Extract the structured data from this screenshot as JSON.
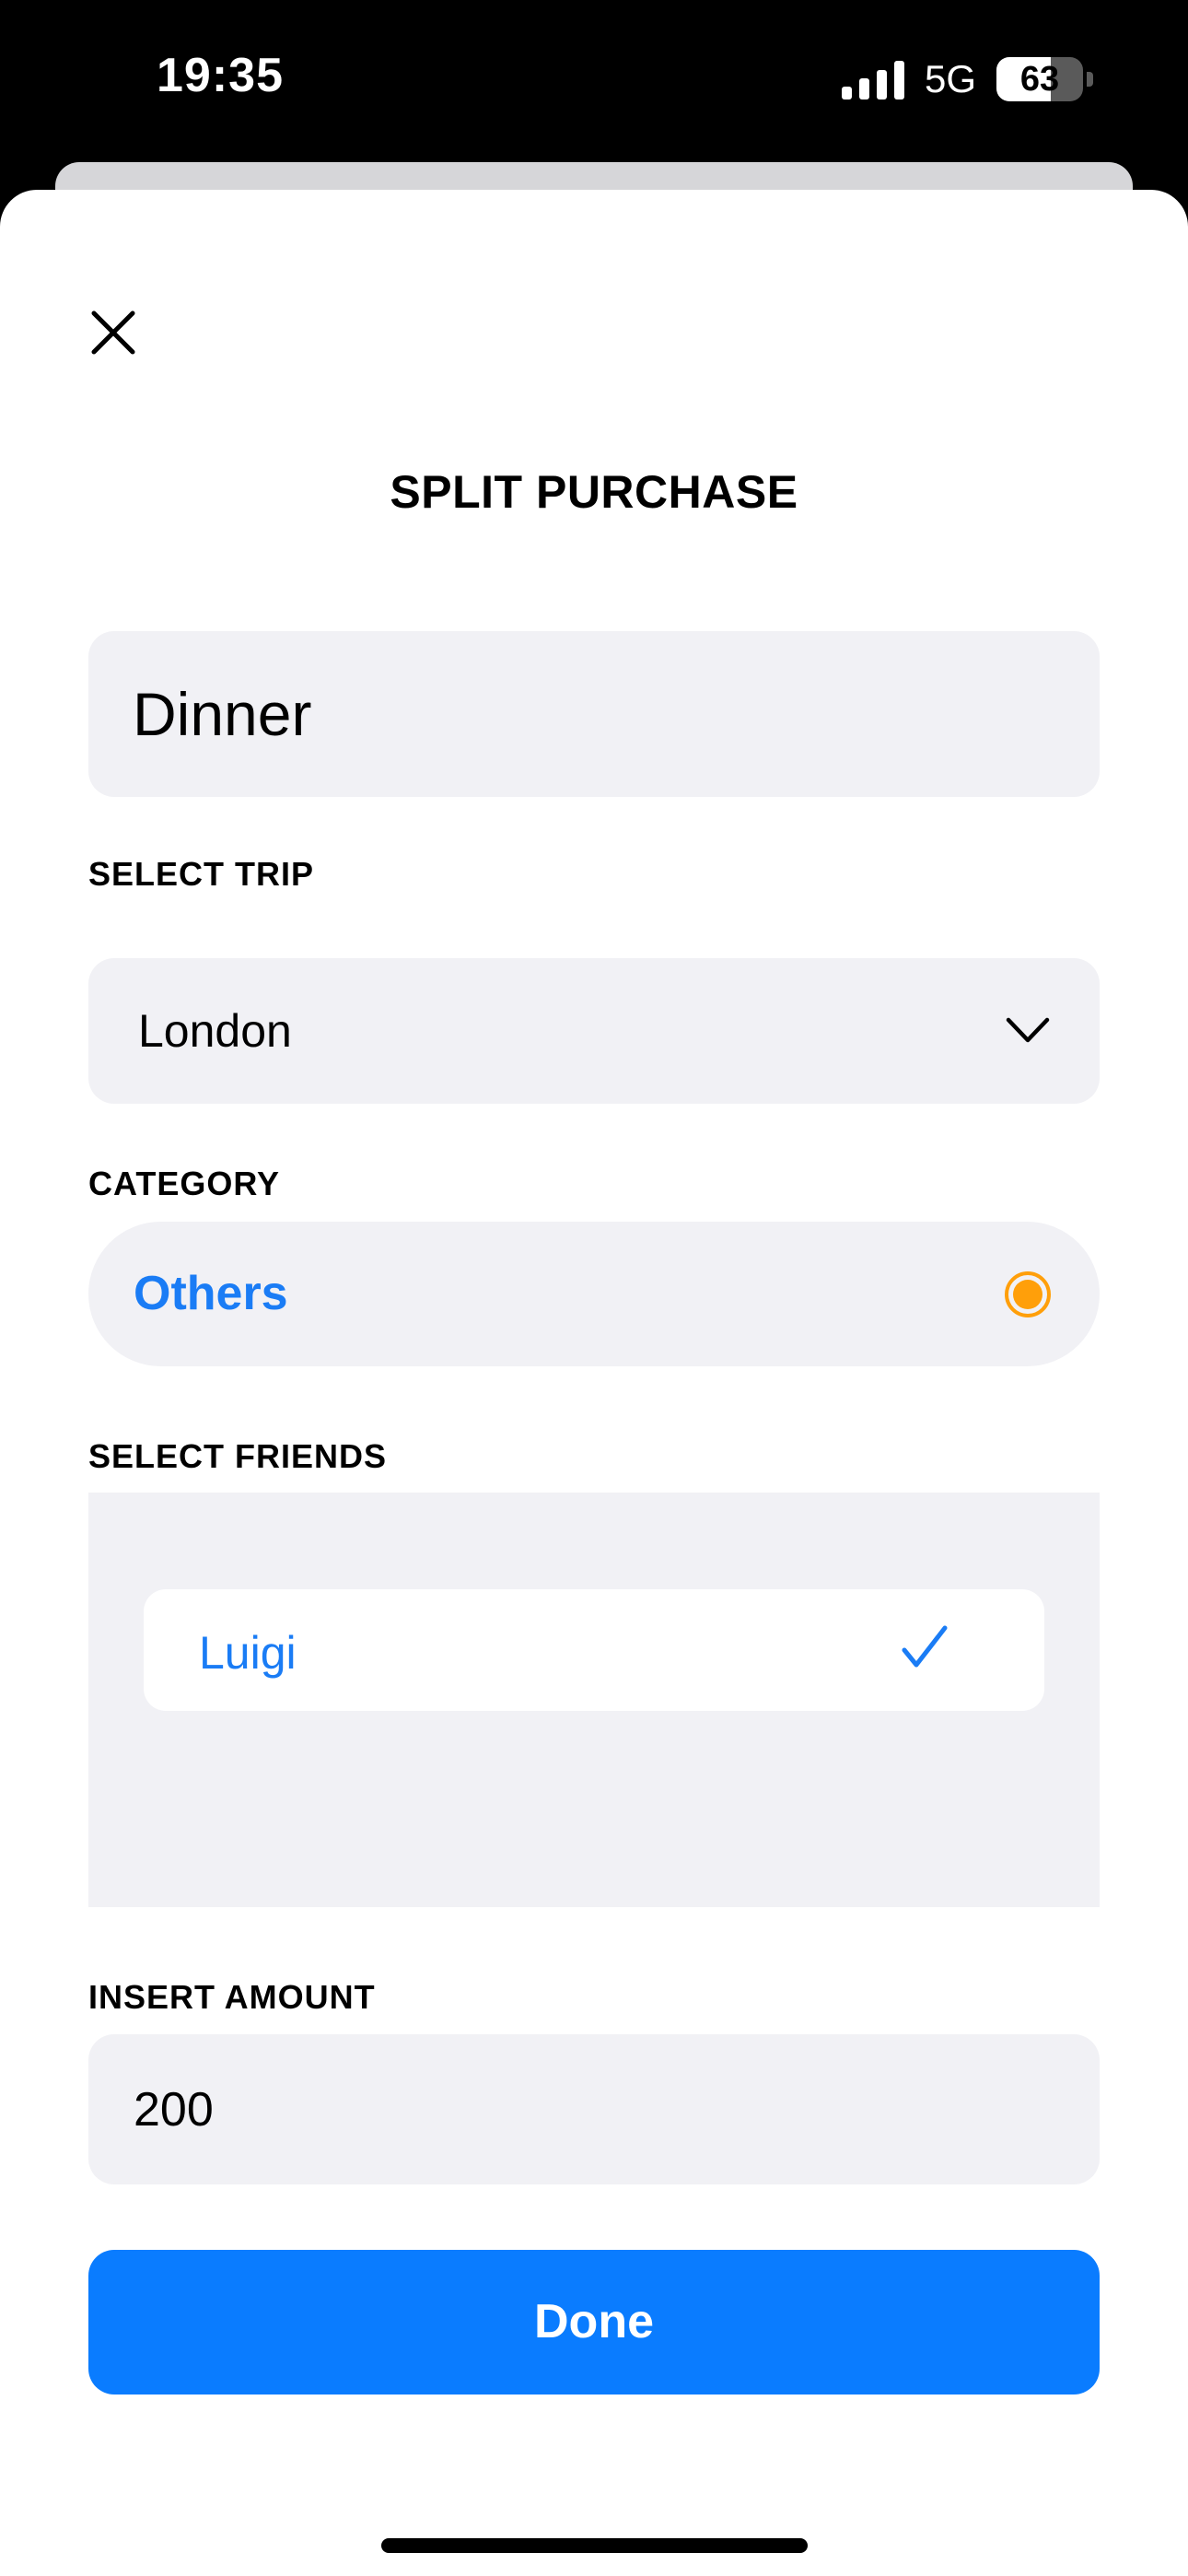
{
  "status_bar": {
    "time": "19:35",
    "network": "5G",
    "battery_level": "63",
    "battery_fraction": 0.63
  },
  "header": {
    "title": "SPLIT PURCHASE",
    "close_icon": "close-icon"
  },
  "purchase": {
    "name_value": "Dinner"
  },
  "trip": {
    "label": "SELECT TRIP",
    "selected": "London",
    "icon": "chevron-down-icon"
  },
  "category": {
    "label": "CATEGORY",
    "selected": "Others",
    "dot_color": "#ff9f0a",
    "icon": "category-dot-icon"
  },
  "friends": {
    "label": "SELECT FRIENDS",
    "items": [
      {
        "name": "Luigi",
        "selected": true,
        "icon": "checkmark-icon"
      }
    ]
  },
  "amount": {
    "label": "INSERT AMOUNT",
    "value": "200"
  },
  "actions": {
    "done_label": "Done"
  },
  "colors": {
    "accent": "#0a7cff",
    "link_blue": "#1a7cf5",
    "field_background": "#f1f1f5",
    "category_dot": "#ff9f0a"
  }
}
